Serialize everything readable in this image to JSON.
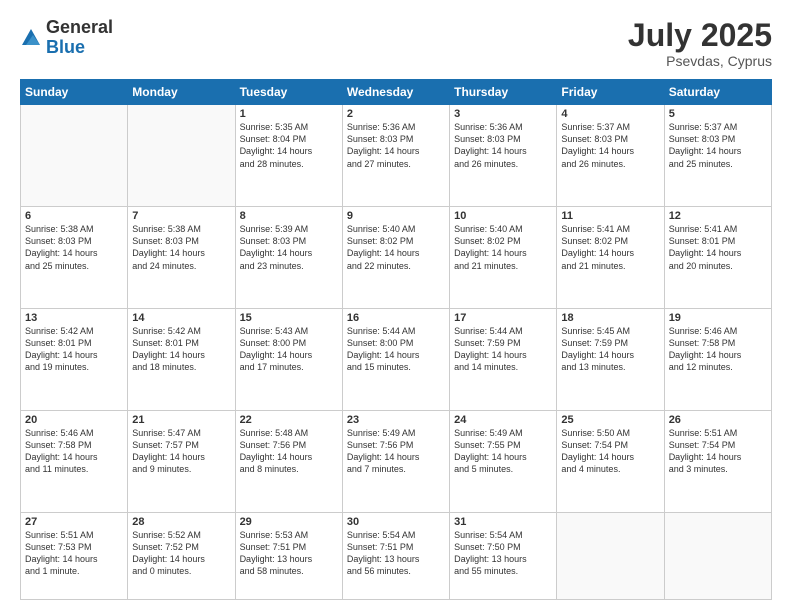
{
  "header": {
    "logo_general": "General",
    "logo_blue": "Blue",
    "main_title": "July 2025",
    "subtitle": "Psevdas, Cyprus"
  },
  "days_of_week": [
    "Sunday",
    "Monday",
    "Tuesday",
    "Wednesday",
    "Thursday",
    "Friday",
    "Saturday"
  ],
  "weeks": [
    [
      {
        "day": "",
        "sunrise": "",
        "sunset": "",
        "daylight": ""
      },
      {
        "day": "",
        "sunrise": "",
        "sunset": "",
        "daylight": ""
      },
      {
        "day": "1",
        "sunrise": "Sunrise: 5:35 AM",
        "sunset": "Sunset: 8:04 PM",
        "daylight": "Daylight: 14 hours and 28 minutes."
      },
      {
        "day": "2",
        "sunrise": "Sunrise: 5:36 AM",
        "sunset": "Sunset: 8:03 PM",
        "daylight": "Daylight: 14 hours and 27 minutes."
      },
      {
        "day": "3",
        "sunrise": "Sunrise: 5:36 AM",
        "sunset": "Sunset: 8:03 PM",
        "daylight": "Daylight: 14 hours and 26 minutes."
      },
      {
        "day": "4",
        "sunrise": "Sunrise: 5:37 AM",
        "sunset": "Sunset: 8:03 PM",
        "daylight": "Daylight: 14 hours and 26 minutes."
      },
      {
        "day": "5",
        "sunrise": "Sunrise: 5:37 AM",
        "sunset": "Sunset: 8:03 PM",
        "daylight": "Daylight: 14 hours and 25 minutes."
      }
    ],
    [
      {
        "day": "6",
        "sunrise": "Sunrise: 5:38 AM",
        "sunset": "Sunset: 8:03 PM",
        "daylight": "Daylight: 14 hours and 25 minutes."
      },
      {
        "day": "7",
        "sunrise": "Sunrise: 5:38 AM",
        "sunset": "Sunset: 8:03 PM",
        "daylight": "Daylight: 14 hours and 24 minutes."
      },
      {
        "day": "8",
        "sunrise": "Sunrise: 5:39 AM",
        "sunset": "Sunset: 8:03 PM",
        "daylight": "Daylight: 14 hours and 23 minutes."
      },
      {
        "day": "9",
        "sunrise": "Sunrise: 5:40 AM",
        "sunset": "Sunset: 8:02 PM",
        "daylight": "Daylight: 14 hours and 22 minutes."
      },
      {
        "day": "10",
        "sunrise": "Sunrise: 5:40 AM",
        "sunset": "Sunset: 8:02 PM",
        "daylight": "Daylight: 14 hours and 21 minutes."
      },
      {
        "day": "11",
        "sunrise": "Sunrise: 5:41 AM",
        "sunset": "Sunset: 8:02 PM",
        "daylight": "Daylight: 14 hours and 21 minutes."
      },
      {
        "day": "12",
        "sunrise": "Sunrise: 5:41 AM",
        "sunset": "Sunset: 8:01 PM",
        "daylight": "Daylight: 14 hours and 20 minutes."
      }
    ],
    [
      {
        "day": "13",
        "sunrise": "Sunrise: 5:42 AM",
        "sunset": "Sunset: 8:01 PM",
        "daylight": "Daylight: 14 hours and 19 minutes."
      },
      {
        "day": "14",
        "sunrise": "Sunrise: 5:42 AM",
        "sunset": "Sunset: 8:01 PM",
        "daylight": "Daylight: 14 hours and 18 minutes."
      },
      {
        "day": "15",
        "sunrise": "Sunrise: 5:43 AM",
        "sunset": "Sunset: 8:00 PM",
        "daylight": "Daylight: 14 hours and 17 minutes."
      },
      {
        "day": "16",
        "sunrise": "Sunrise: 5:44 AM",
        "sunset": "Sunset: 8:00 PM",
        "daylight": "Daylight: 14 hours and 15 minutes."
      },
      {
        "day": "17",
        "sunrise": "Sunrise: 5:44 AM",
        "sunset": "Sunset: 7:59 PM",
        "daylight": "Daylight: 14 hours and 14 minutes."
      },
      {
        "day": "18",
        "sunrise": "Sunrise: 5:45 AM",
        "sunset": "Sunset: 7:59 PM",
        "daylight": "Daylight: 14 hours and 13 minutes."
      },
      {
        "day": "19",
        "sunrise": "Sunrise: 5:46 AM",
        "sunset": "Sunset: 7:58 PM",
        "daylight": "Daylight: 14 hours and 12 minutes."
      }
    ],
    [
      {
        "day": "20",
        "sunrise": "Sunrise: 5:46 AM",
        "sunset": "Sunset: 7:58 PM",
        "daylight": "Daylight: 14 hours and 11 minutes."
      },
      {
        "day": "21",
        "sunrise": "Sunrise: 5:47 AM",
        "sunset": "Sunset: 7:57 PM",
        "daylight": "Daylight: 14 hours and 9 minutes."
      },
      {
        "day": "22",
        "sunrise": "Sunrise: 5:48 AM",
        "sunset": "Sunset: 7:56 PM",
        "daylight": "Daylight: 14 hours and 8 minutes."
      },
      {
        "day": "23",
        "sunrise": "Sunrise: 5:49 AM",
        "sunset": "Sunset: 7:56 PM",
        "daylight": "Daylight: 14 hours and 7 minutes."
      },
      {
        "day": "24",
        "sunrise": "Sunrise: 5:49 AM",
        "sunset": "Sunset: 7:55 PM",
        "daylight": "Daylight: 14 hours and 5 minutes."
      },
      {
        "day": "25",
        "sunrise": "Sunrise: 5:50 AM",
        "sunset": "Sunset: 7:54 PM",
        "daylight": "Daylight: 14 hours and 4 minutes."
      },
      {
        "day": "26",
        "sunrise": "Sunrise: 5:51 AM",
        "sunset": "Sunset: 7:54 PM",
        "daylight": "Daylight: 14 hours and 3 minutes."
      }
    ],
    [
      {
        "day": "27",
        "sunrise": "Sunrise: 5:51 AM",
        "sunset": "Sunset: 7:53 PM",
        "daylight": "Daylight: 14 hours and 1 minute."
      },
      {
        "day": "28",
        "sunrise": "Sunrise: 5:52 AM",
        "sunset": "Sunset: 7:52 PM",
        "daylight": "Daylight: 14 hours and 0 minutes."
      },
      {
        "day": "29",
        "sunrise": "Sunrise: 5:53 AM",
        "sunset": "Sunset: 7:51 PM",
        "daylight": "Daylight: 13 hours and 58 minutes."
      },
      {
        "day": "30",
        "sunrise": "Sunrise: 5:54 AM",
        "sunset": "Sunset: 7:51 PM",
        "daylight": "Daylight: 13 hours and 56 minutes."
      },
      {
        "day": "31",
        "sunrise": "Sunrise: 5:54 AM",
        "sunset": "Sunset: 7:50 PM",
        "daylight": "Daylight: 13 hours and 55 minutes."
      },
      {
        "day": "",
        "sunrise": "",
        "sunset": "",
        "daylight": ""
      },
      {
        "day": "",
        "sunrise": "",
        "sunset": "",
        "daylight": ""
      }
    ]
  ]
}
